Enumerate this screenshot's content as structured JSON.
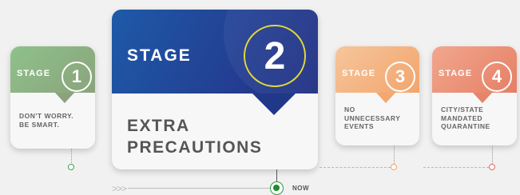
{
  "stages": [
    {
      "word": "STAGE",
      "number": "1",
      "description": "DON'T WORRY.\nBE SMART.",
      "color": "#8aa37c",
      "status": "past"
    },
    {
      "word": "STAGE",
      "number": "2",
      "description": "EXTRA\nPRECAUTIONS",
      "color": "#233f93",
      "status": "current"
    },
    {
      "word": "STAGE",
      "number": "3",
      "description": "NO\nUNNECESSARY\nEVENTS",
      "color": "#f2a56d",
      "status": "future"
    },
    {
      "word": "STAGE",
      "number": "4",
      "description": "CITY/STATE\nMANDATED\nQUARANTINE",
      "color": "#e57f66",
      "status": "future"
    }
  ],
  "timeline": {
    "now_label": "NOW",
    "arrows": ">>>",
    "current_color": "#1f8c34",
    "past_dot_color": "#3aa64a",
    "future_dot_colors": [
      "#f2a56d",
      "#e06e5a"
    ]
  }
}
